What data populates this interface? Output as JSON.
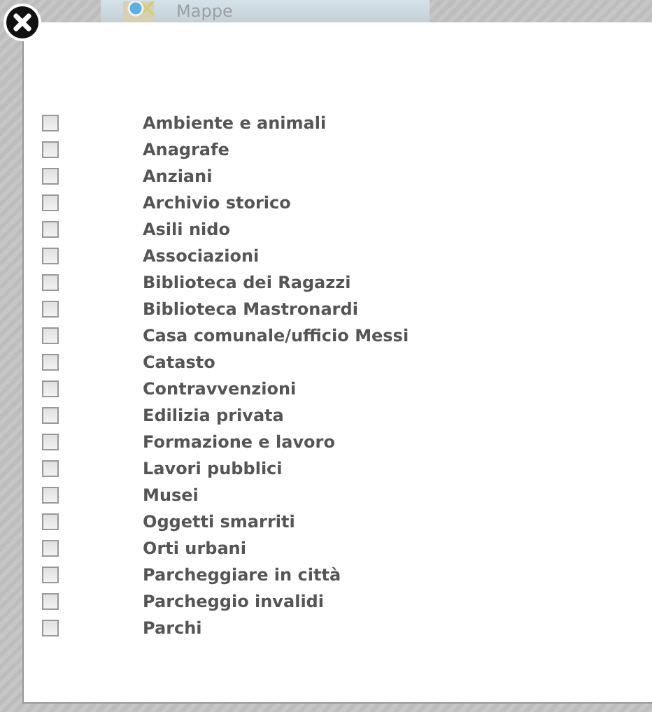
{
  "background": {
    "menu_item": "Mappe"
  },
  "items": [
    {
      "label": "Ambiente e animali",
      "checked": false
    },
    {
      "label": "Anagrafe",
      "checked": false
    },
    {
      "label": "Anziani",
      "checked": false
    },
    {
      "label": "Archivio storico",
      "checked": false
    },
    {
      "label": "Asili nido",
      "checked": false
    },
    {
      "label": "Associazioni",
      "checked": false
    },
    {
      "label": "Biblioteca dei Ragazzi",
      "checked": false
    },
    {
      "label": "Biblioteca Mastronardi",
      "checked": false
    },
    {
      "label": "Casa comunale/ufficio Messi",
      "checked": false
    },
    {
      "label": "Catasto",
      "checked": false
    },
    {
      "label": "Contravvenzioni",
      "checked": false
    },
    {
      "label": "Edilizia privata",
      "checked": false
    },
    {
      "label": "Formazione e lavoro",
      "checked": false
    },
    {
      "label": "Lavori pubblici",
      "checked": false
    },
    {
      "label": "Musei",
      "checked": false
    },
    {
      "label": "Oggetti smarriti",
      "checked": false
    },
    {
      "label": "Orti urbani",
      "checked": false
    },
    {
      "label": "Parcheggiare in città",
      "checked": false
    },
    {
      "label": "Parcheggio invalidi",
      "checked": false
    },
    {
      "label": "Parchi",
      "checked": false
    }
  ]
}
